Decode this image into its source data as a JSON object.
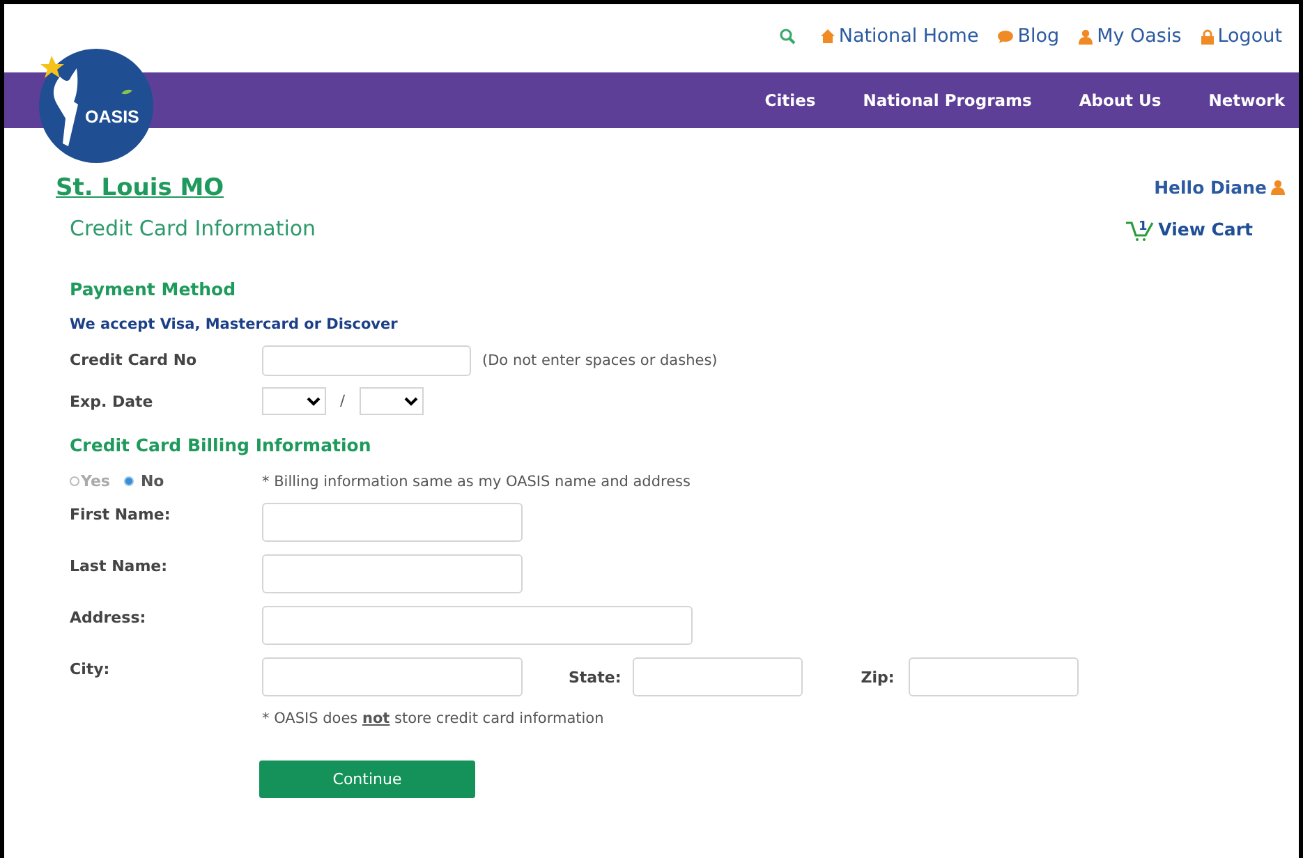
{
  "logo": {
    "text": "OASIS"
  },
  "top_links": [
    {
      "kind": "search"
    },
    {
      "kind": "home",
      "label": "National Home"
    },
    {
      "kind": "chat",
      "label": "Blog"
    },
    {
      "kind": "person",
      "label": "My Oasis"
    },
    {
      "kind": "lock",
      "label": "Logout"
    }
  ],
  "nav": [
    "Cities",
    "National Programs",
    "About Us",
    "Network"
  ],
  "location": "St. Louis MO",
  "greeting": "Hello Diane",
  "page_title": "Credit Card Information",
  "cart": {
    "count": "1",
    "label": "View Cart"
  },
  "payment": {
    "heading": "Payment Method",
    "accept_note": "We accept Visa, Mastercard or Discover",
    "card_label": "Credit Card No",
    "card_hint": "(Do not enter spaces or dashes)",
    "exp_label": "Exp. Date",
    "separator": "/"
  },
  "billing": {
    "heading": "Credit Card Billing Information",
    "options": [
      {
        "label": "Yes",
        "selected": false
      },
      {
        "label": "No",
        "selected": true
      }
    ],
    "same_note": "* Billing information same as my OASIS name and address",
    "fields": [
      {
        "label": "First Name:",
        "kind": "short"
      },
      {
        "label": "Last Name:",
        "kind": "short"
      },
      {
        "label": "Address:",
        "kind": "long"
      }
    ],
    "city_label": "City:",
    "state_label": "State:",
    "zip_label": "Zip:",
    "store_note": "* OASIS does **not** store credit card information"
  },
  "button": "Continue"
}
